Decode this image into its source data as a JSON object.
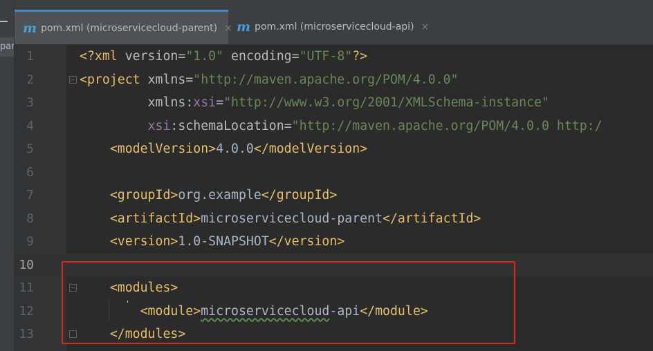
{
  "project_panel": {
    "truncated_label": "par"
  },
  "tabs": [
    {
      "icon": "maven-m-icon",
      "icon_glyph": "m",
      "label": "pom.xml (microservicecloud-parent)",
      "close": "×",
      "active": true
    },
    {
      "icon": "maven-m-icon",
      "icon_glyph": "m",
      "label": "pom.xml (microservicecloud-api)",
      "close": "×",
      "active": false
    }
  ],
  "editor": {
    "current_line": 10,
    "lines": [
      {
        "n": "1",
        "tokens": [
          [
            "tg",
            "<?xml "
          ],
          [
            "at",
            "version"
          ],
          [
            "tx",
            "="
          ],
          [
            "av",
            "\"1.0\""
          ],
          [
            "at",
            " encoding"
          ],
          [
            "tx",
            "="
          ],
          [
            "av",
            "\"UTF-8\""
          ],
          [
            "tg",
            "?>"
          ]
        ]
      },
      {
        "n": "2",
        "tokens": [
          [
            "tg",
            "<project "
          ],
          [
            "at",
            "xmlns"
          ],
          [
            "tx",
            "="
          ],
          [
            "av",
            "\"http://maven.apache.org/POM/4.0.0\""
          ]
        ]
      },
      {
        "n": "3",
        "tokens": [
          [
            "tx",
            "         "
          ],
          [
            "at",
            "xmlns"
          ],
          [
            "tx",
            ":"
          ],
          [
            "ns",
            "xsi"
          ],
          [
            "tx",
            "="
          ],
          [
            "av",
            "\"http://www.w3.org/2001/XMLSchema-instance\""
          ]
        ]
      },
      {
        "n": "4",
        "tokens": [
          [
            "tx",
            "         "
          ],
          [
            "ns",
            "xsi"
          ],
          [
            "tx",
            ":"
          ],
          [
            "at",
            "schemaLocation"
          ],
          [
            "tx",
            "="
          ],
          [
            "av",
            "\"http://maven.apache.org/POM/4.0.0 http:/"
          ]
        ]
      },
      {
        "n": "5",
        "tokens": [
          [
            "tx",
            "    "
          ],
          [
            "tg",
            "<modelVersion>"
          ],
          [
            "tx",
            "4.0.0"
          ],
          [
            "tg",
            "</modelVersion>"
          ]
        ]
      },
      {
        "n": "6",
        "tokens": []
      },
      {
        "n": "7",
        "tokens": [
          [
            "tx",
            "    "
          ],
          [
            "tg",
            "<groupId>"
          ],
          [
            "tx",
            "org.example"
          ],
          [
            "tg",
            "</groupId>"
          ]
        ]
      },
      {
        "n": "8",
        "tokens": [
          [
            "tx",
            "    "
          ],
          [
            "tg",
            "<artifactId>"
          ],
          [
            "tx",
            "microservicecloud-parent"
          ],
          [
            "tg",
            "</artifactId>"
          ]
        ]
      },
      {
        "n": "9",
        "tokens": [
          [
            "tx",
            "    "
          ],
          [
            "tg",
            "<version>"
          ],
          [
            "tx",
            "1.0-SNAPSHOT"
          ],
          [
            "tg",
            "</version>"
          ]
        ]
      },
      {
        "n": "10",
        "tokens": []
      },
      {
        "n": "11",
        "tokens": [
          [
            "tx",
            "    "
          ],
          [
            "tg",
            "<modules>"
          ]
        ]
      },
      {
        "n": "12",
        "tokens": [
          [
            "tx",
            "        "
          ],
          [
            "tg",
            "<module>"
          ],
          [
            "tx spell",
            "microservicecloud"
          ],
          [
            "tx",
            "-api"
          ],
          [
            "tg",
            "</module>"
          ]
        ]
      },
      {
        "n": "13",
        "tokens": [
          [
            "tx",
            "    "
          ],
          [
            "tg",
            "</modules>"
          ]
        ]
      }
    ]
  },
  "colors": {
    "background": "#2b2b2b",
    "tag": "#e8bf6a",
    "attribute_value": "#6a8759",
    "namespace": "#9876aa",
    "highlight_box": "#e0231c",
    "active_tab_border": "#4a88c7"
  }
}
